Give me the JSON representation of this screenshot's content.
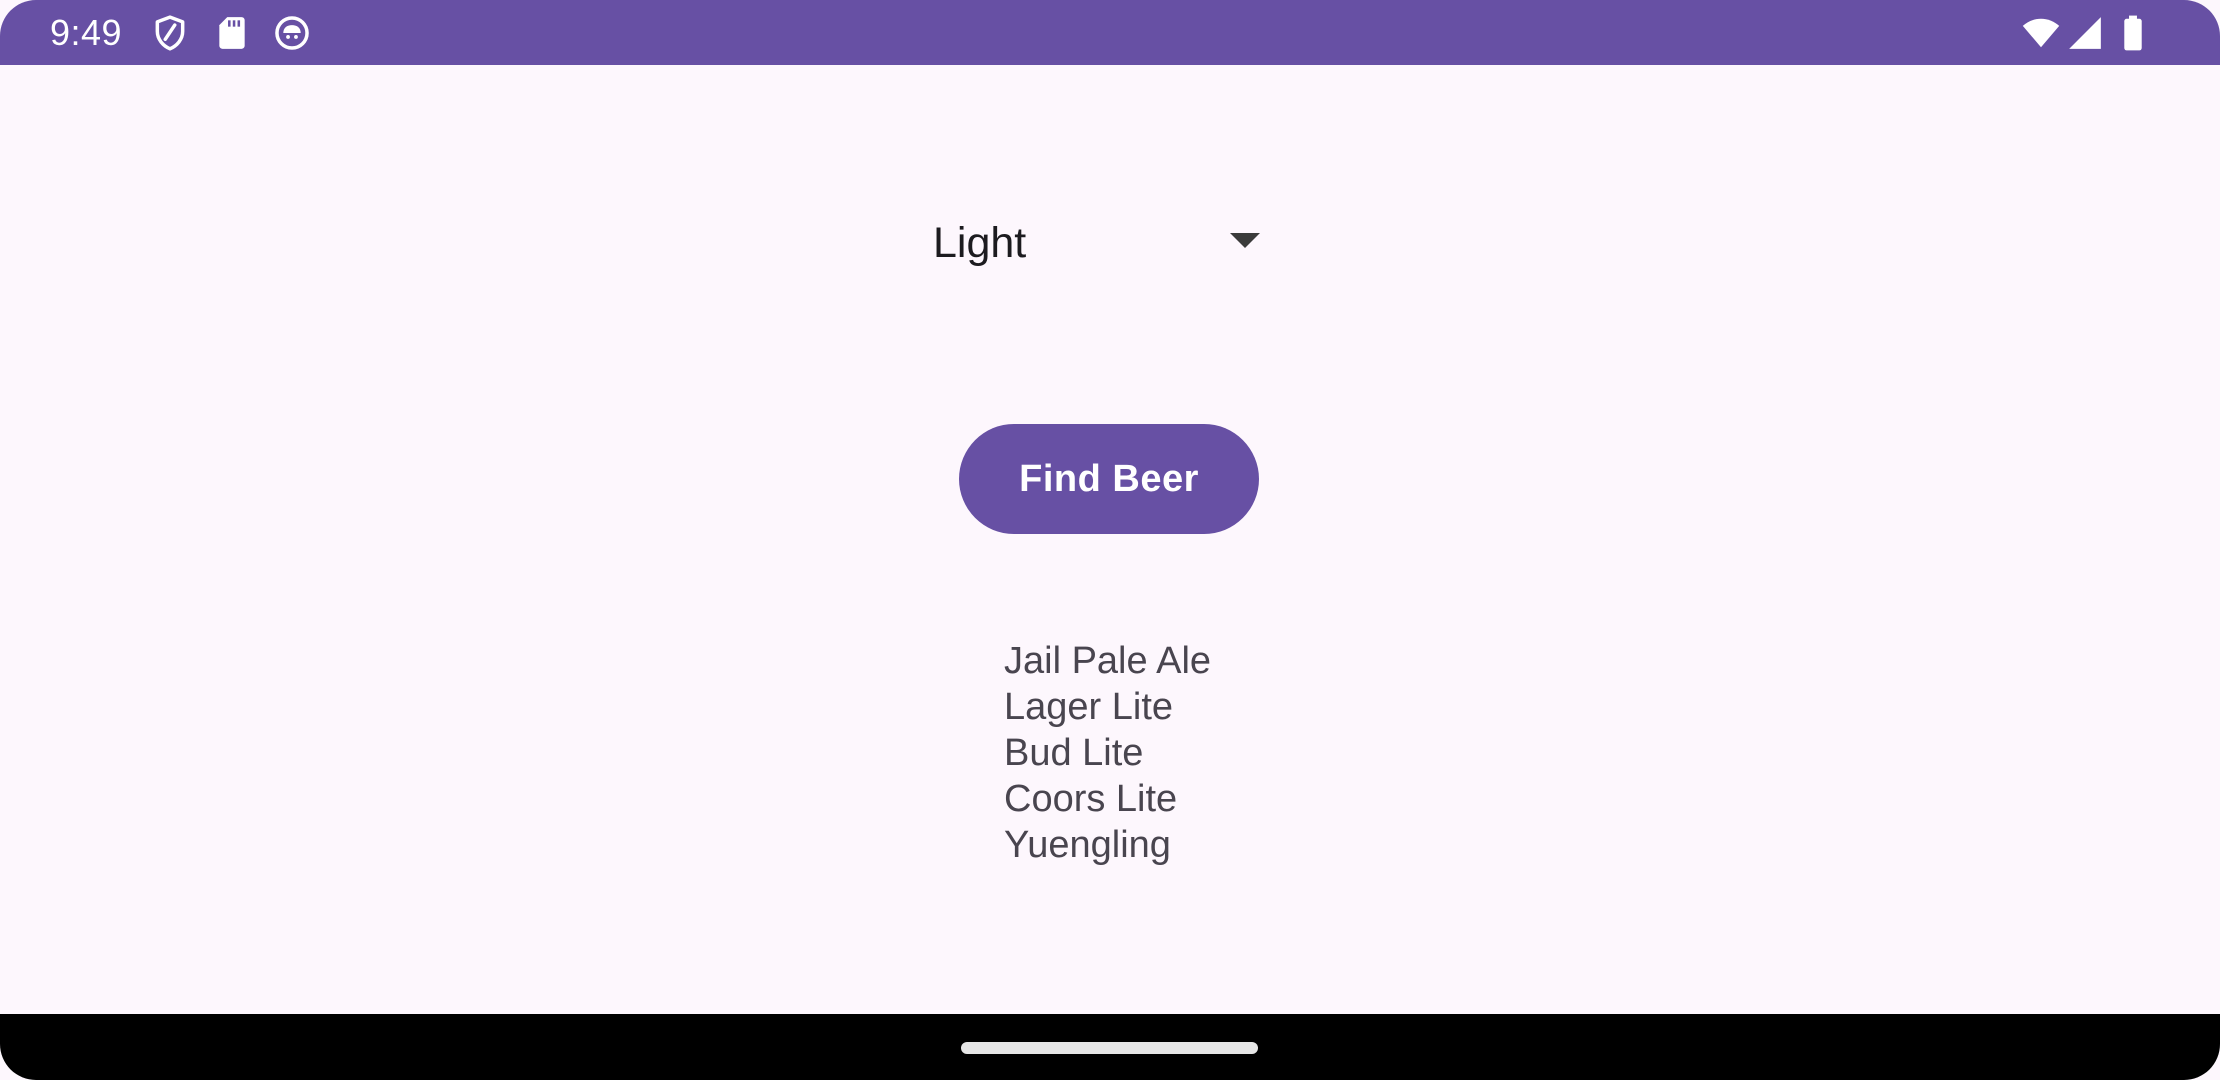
{
  "status_bar": {
    "time": "9:49",
    "background": "#6750a4",
    "left_icons": [
      "shield-icon",
      "sd-card-icon",
      "android-face-icon"
    ],
    "right_icons": [
      "wifi-icon",
      "cell-signal-icon",
      "battery-icon"
    ]
  },
  "spinner": {
    "selected": "Light",
    "icon": "chevron-down-icon"
  },
  "find_button": {
    "label": "Find Beer",
    "color": "#6750a4"
  },
  "results": {
    "items": [
      "Jail Pale Ale",
      "Lager Lite",
      "Bud Lite",
      "Coors Lite",
      "Yuengling"
    ]
  },
  "nav_bar": {
    "background": "#000000",
    "handle": "home-gesture-handle"
  }
}
